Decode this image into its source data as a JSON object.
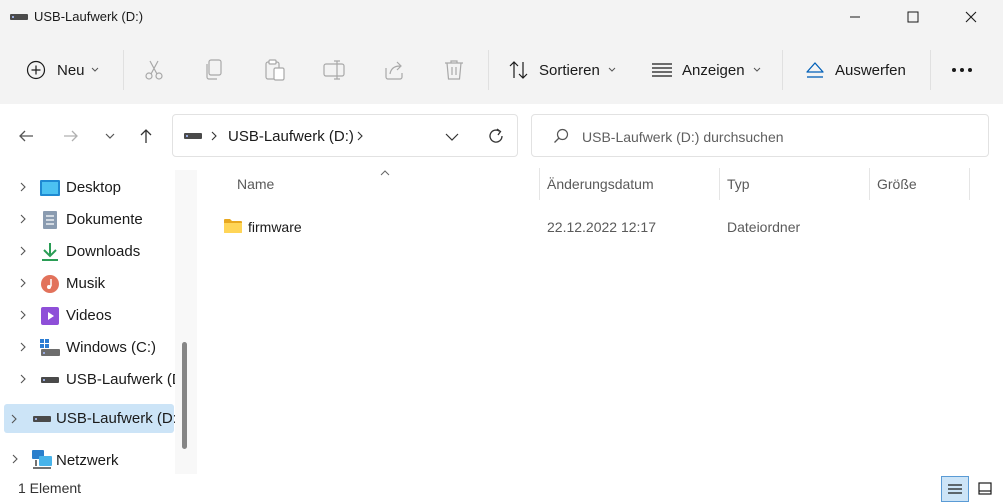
{
  "window": {
    "title": "USB-Laufwerk (D:)"
  },
  "toolbar": {
    "new_label": "Neu",
    "sort_label": "Sortieren",
    "view_label": "Anzeigen",
    "eject_label": "Auswerfen"
  },
  "address": {
    "breadcrumb_item": "USB-Laufwerk (D:)"
  },
  "search": {
    "placeholder": "USB-Laufwerk (D:) durchsuchen"
  },
  "sidebar": {
    "items": [
      {
        "label": "Desktop",
        "icon": "desktop-icon"
      },
      {
        "label": "Dokumente",
        "icon": "documents-icon"
      },
      {
        "label": "Downloads",
        "icon": "downloads-icon"
      },
      {
        "label": "Musik",
        "icon": "music-icon"
      },
      {
        "label": "Videos",
        "icon": "videos-icon"
      },
      {
        "label": "Windows (C:)",
        "icon": "windows-drive-icon"
      },
      {
        "label": "USB-Laufwerk (D:)",
        "icon": "usb-drive-icon"
      },
      {
        "label": "USB-Laufwerk (D:)",
        "icon": "usb-drive-icon",
        "selected": true
      },
      {
        "label": "Netzwerk",
        "icon": "network-icon"
      }
    ]
  },
  "table": {
    "columns": [
      "Name",
      "Änderungsdatum",
      "Typ",
      "Größe"
    ],
    "rows": [
      {
        "name": "firmware",
        "date": "22.12.2022 12:17",
        "type": "Dateiordner",
        "size": ""
      }
    ]
  },
  "status": {
    "count": "1 Element"
  },
  "colors": {
    "accent": "#005fb8",
    "selected_bg": "#cce4f7",
    "toolbar_bg": "#f3f3f3"
  }
}
